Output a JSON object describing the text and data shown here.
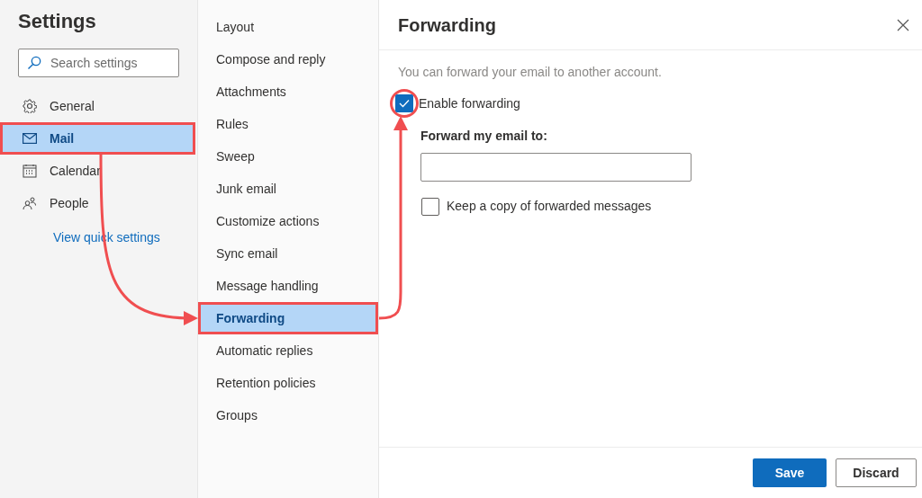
{
  "sidebar": {
    "title": "Settings",
    "search": {
      "placeholder": "Search settings"
    },
    "items": [
      {
        "label": "General",
        "kind": "gear",
        "selected": false,
        "highlighted": false
      },
      {
        "label": "Mail",
        "kind": "mail",
        "selected": true,
        "highlighted": true
      },
      {
        "label": "Calendar",
        "kind": "calendar",
        "selected": false,
        "highlighted": false
      },
      {
        "label": "People",
        "kind": "people",
        "selected": false,
        "highlighted": false
      }
    ],
    "link": "View quick settings"
  },
  "subnav": {
    "items": [
      {
        "label": "Layout",
        "selected": false,
        "highlighted": false
      },
      {
        "label": "Compose and reply",
        "selected": false,
        "highlighted": false
      },
      {
        "label": "Attachments",
        "selected": false,
        "highlighted": false
      },
      {
        "label": "Rules",
        "selected": false,
        "highlighted": false
      },
      {
        "label": "Sweep",
        "selected": false,
        "highlighted": false
      },
      {
        "label": "Junk email",
        "selected": false,
        "highlighted": false
      },
      {
        "label": "Customize actions",
        "selected": false,
        "highlighted": false
      },
      {
        "label": "Sync email",
        "selected": false,
        "highlighted": false
      },
      {
        "label": "Message handling",
        "selected": false,
        "highlighted": false
      },
      {
        "label": "Forwarding",
        "selected": true,
        "highlighted": true
      },
      {
        "label": "Automatic replies",
        "selected": false,
        "highlighted": false
      },
      {
        "label": "Retention policies",
        "selected": false,
        "highlighted": false
      },
      {
        "label": "Groups",
        "selected": false,
        "highlighted": false
      }
    ]
  },
  "panel": {
    "title": "Forwarding",
    "description": "You can forward your email to another account.",
    "enable": {
      "label": "Enable forwarding",
      "checked": true,
      "circled": true
    },
    "field_label": "Forward my email to:",
    "keep_copy": {
      "label": "Keep a copy of forwarded messages",
      "checked": false
    },
    "buttons": [
      {
        "label": "Save",
        "kind": "primary"
      },
      {
        "label": "Discard",
        "kind": "secondary"
      }
    ]
  }
}
